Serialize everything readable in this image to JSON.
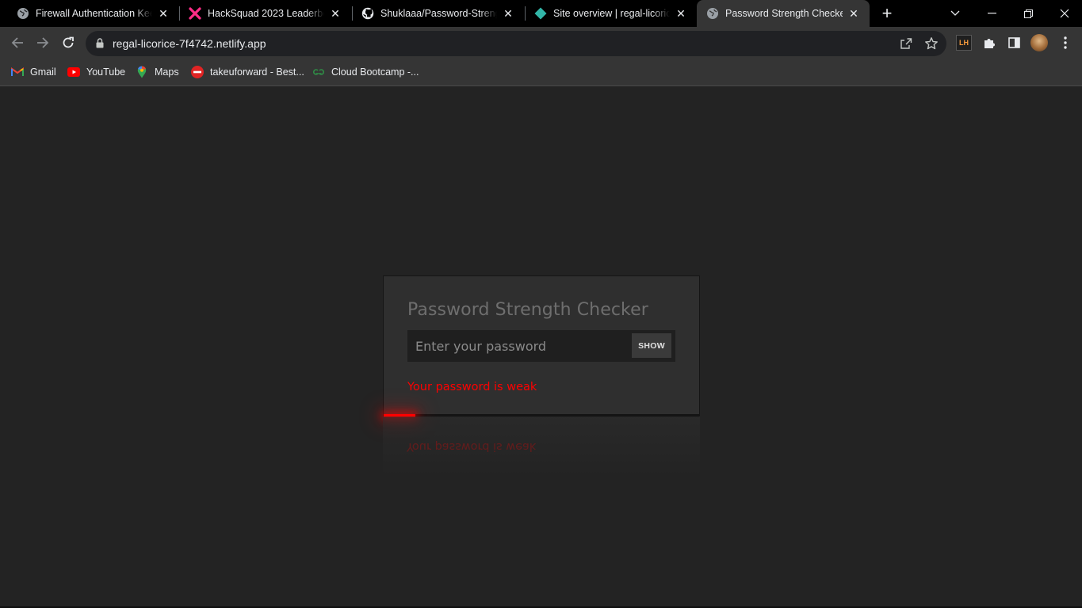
{
  "browser": {
    "tabs": [
      {
        "title": "Firewall Authentication Keep",
        "icon": "globe-icon",
        "active": false
      },
      {
        "title": "HackSquad 2023 Leaderboard",
        "icon": "hacksquad-x-icon",
        "active": false
      },
      {
        "title": "Shuklaaa/Password-Strength",
        "icon": "github-icon",
        "active": false
      },
      {
        "title": "Site overview | regal-licorice",
        "icon": "netlify-icon",
        "active": false
      },
      {
        "title": "Password Strength Checker",
        "icon": "globe-icon",
        "active": true
      }
    ],
    "url": "regal-licorice-7f4742.netlify.app",
    "bookmarks": [
      {
        "label": "Gmail",
        "icon": "gmail-icon"
      },
      {
        "label": "YouTube",
        "icon": "youtube-icon"
      },
      {
        "label": "Maps",
        "icon": "maps-icon"
      },
      {
        "label": "takeuforward - Best...",
        "icon": "tuf-icon"
      },
      {
        "label": "Cloud Bootcamp -...",
        "icon": "geeksforgeeks-icon"
      }
    ],
    "extensions": {
      "lighthouse_label": "LH"
    }
  },
  "app": {
    "title": "Password Strength Checker",
    "password_placeholder": "Enter your password",
    "show_button": "SHOW",
    "strength_message": "Your password is weak",
    "strength_level": 0.1,
    "strength_color": "#ff0000"
  }
}
